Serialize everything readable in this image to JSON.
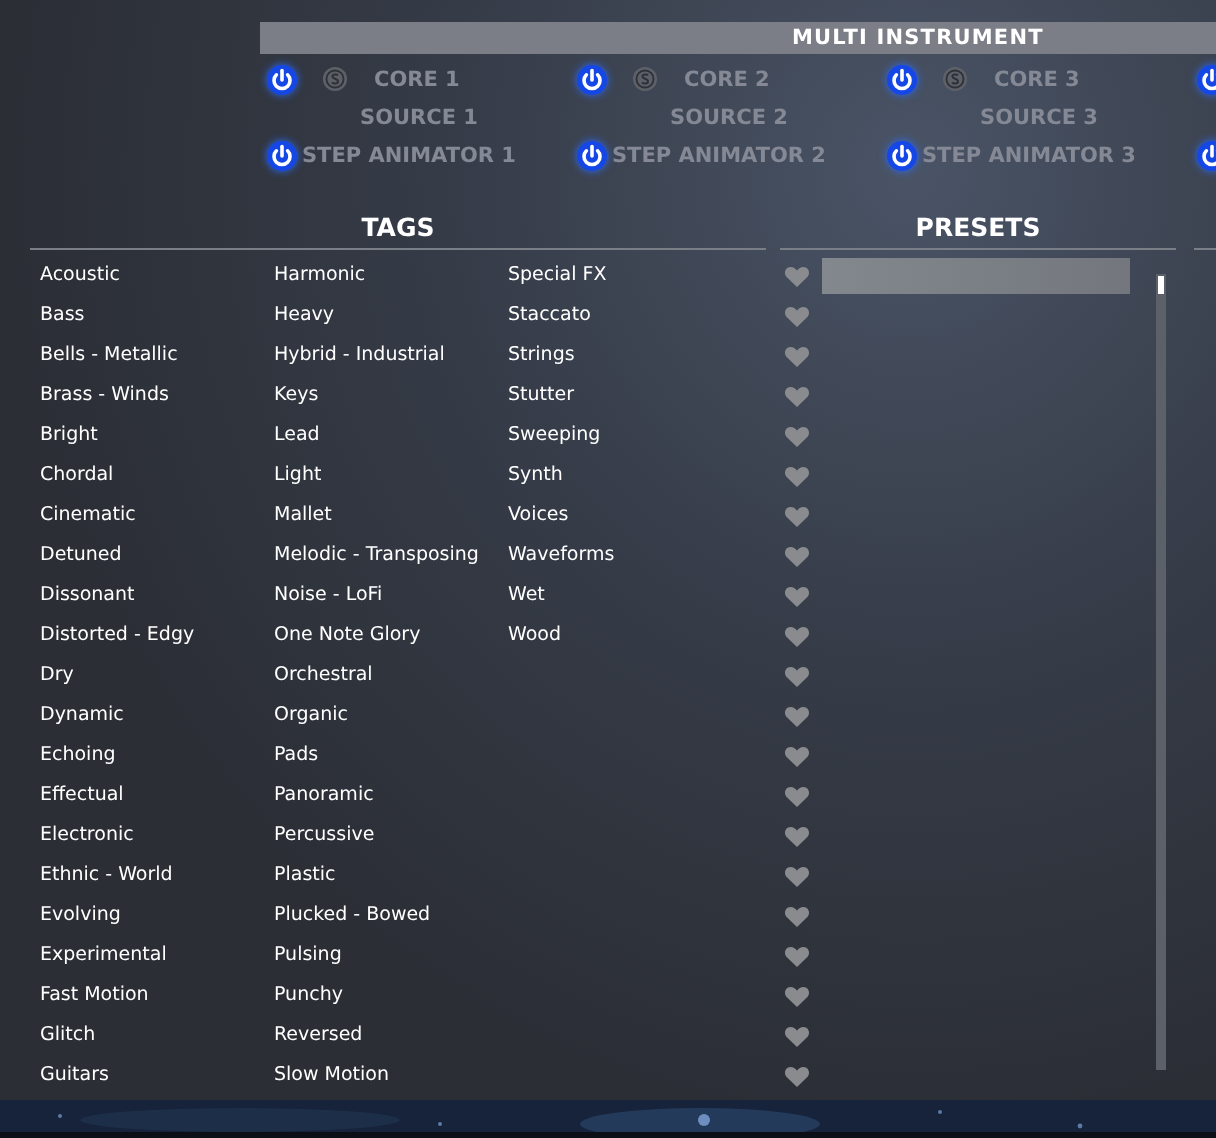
{
  "header": {
    "title": "MULTI INSTRUMENT"
  },
  "modules": [
    {
      "core": {
        "label": "CORE 1",
        "power_on": true,
        "solo": false
      },
      "source": "SOURCE 1",
      "animator": {
        "label": "STEP ANIMATOR 1",
        "power_on": true
      }
    },
    {
      "core": {
        "label": "CORE 2",
        "power_on": true,
        "solo": false
      },
      "source": "SOURCE 2",
      "animator": {
        "label": "STEP ANIMATOR 2",
        "power_on": true
      }
    },
    {
      "core": {
        "label": "CORE 3",
        "power_on": true,
        "solo": false
      },
      "source": "SOURCE 3",
      "animator": {
        "label": "STEP ANIMATOR 3",
        "power_on": true
      }
    },
    {
      "core": {
        "power_on": true
      },
      "animator": {
        "power_on": true
      }
    }
  ],
  "tags": {
    "title": "TAGS",
    "columns": [
      [
        "Acoustic",
        "Bass",
        "Bells - Metallic",
        "Brass - Winds",
        "Bright",
        "Chordal",
        "Cinematic",
        "Detuned",
        "Dissonant",
        "Distorted - Edgy",
        "Dry",
        "Dynamic",
        "Echoing",
        "Effectual",
        "Electronic",
        "Ethnic - World",
        "Evolving",
        "Experimental",
        "Fast Motion",
        "Glitch",
        "Guitars"
      ],
      [
        "Harmonic",
        "Heavy",
        "Hybrid - Industrial",
        "Keys",
        "Lead",
        "Light",
        "Mallet",
        "Melodic - Transposing",
        "Noise - LoFi",
        "One Note Glory",
        "Orchestral",
        "Organic",
        "Pads",
        "Panoramic",
        "Percussive",
        "Plastic",
        "Plucked - Bowed",
        "Pulsing",
        "Punchy",
        "Reversed",
        "Slow Motion"
      ],
      [
        "Special FX",
        "Staccato",
        "Strings",
        "Stutter",
        "Sweeping",
        "Synth",
        "Voices",
        "Waveforms",
        "Wet",
        "Wood"
      ]
    ]
  },
  "presets": {
    "title": "PRESETS",
    "rows": [
      {
        "favorite": false,
        "selected": true
      },
      {
        "favorite": false,
        "selected": false
      },
      {
        "favorite": false,
        "selected": false
      },
      {
        "favorite": false,
        "selected": false
      },
      {
        "favorite": false,
        "selected": false
      },
      {
        "favorite": false,
        "selected": false
      },
      {
        "favorite": false,
        "selected": false
      },
      {
        "favorite": false,
        "selected": false
      },
      {
        "favorite": false,
        "selected": false
      },
      {
        "favorite": false,
        "selected": false
      },
      {
        "favorite": false,
        "selected": false
      },
      {
        "favorite": false,
        "selected": false
      },
      {
        "favorite": false,
        "selected": false
      },
      {
        "favorite": false,
        "selected": false
      },
      {
        "favorite": false,
        "selected": false
      },
      {
        "favorite": false,
        "selected": false
      },
      {
        "favorite": false,
        "selected": false
      },
      {
        "favorite": false,
        "selected": false
      },
      {
        "favorite": false,
        "selected": false
      },
      {
        "favorite": false,
        "selected": false
      },
      {
        "favorite": false,
        "selected": false
      }
    ]
  }
}
